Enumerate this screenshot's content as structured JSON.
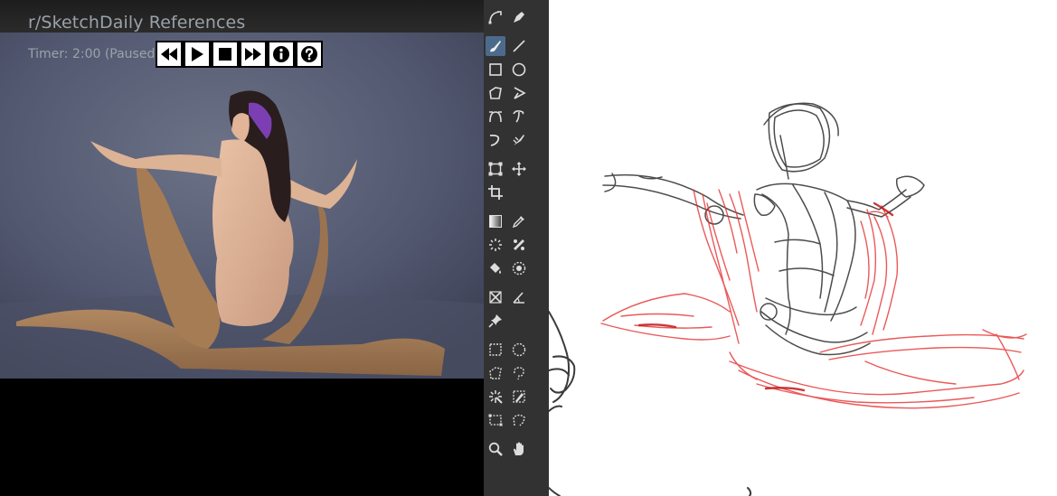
{
  "reference_window": {
    "title": "r/SketchDaily References",
    "timer": "Timer: 2:00 (Paused)",
    "controls": [
      {
        "name": "rewind-button",
        "icon": "rewind-icon"
      },
      {
        "name": "play-button",
        "icon": "play-icon"
      },
      {
        "name": "stop-button",
        "icon": "stop-icon"
      },
      {
        "name": "fast-forward-button",
        "icon": "fast-forward-icon"
      },
      {
        "name": "info-button",
        "icon": "info-icon"
      },
      {
        "name": "help-button",
        "icon": "help-icon"
      }
    ]
  },
  "toolbar": {
    "active_tool": "freehand-brush",
    "tools": [
      "bezier-curve-icon",
      "pen-icon",
      "freehand-brush-icon",
      "line-icon",
      "rectangle-icon",
      "ellipse-icon",
      "polygon-icon",
      "polyline-icon",
      "bezier-tool-icon",
      "freehand-path-icon",
      "dynamic-brush-icon",
      "multibrush-icon",
      "transform-icon",
      "move-icon",
      "crop-icon",
      "gradient-icon",
      "color-picker-icon",
      "smart-patch-icon",
      "fill-icon",
      "fill-icon",
      "enclose-fill-icon",
      "assistant-icon",
      "measure-icon",
      "reference-pin-icon",
      "rect-select-icon",
      "ellipse-select-icon",
      "polygon-select-icon",
      "freehand-select-icon",
      "contiguous-select-icon",
      "similar-color-select-icon",
      "bezier-select-icon",
      "magnetic-select-icon",
      "zoom-icon",
      "pan-icon"
    ]
  },
  "colors": {
    "toolbar_bg": "#323232",
    "active_tool_bg": "#4c6a8c",
    "sketch_black": "#1a1a1a",
    "sketch_red": "#e53030"
  }
}
